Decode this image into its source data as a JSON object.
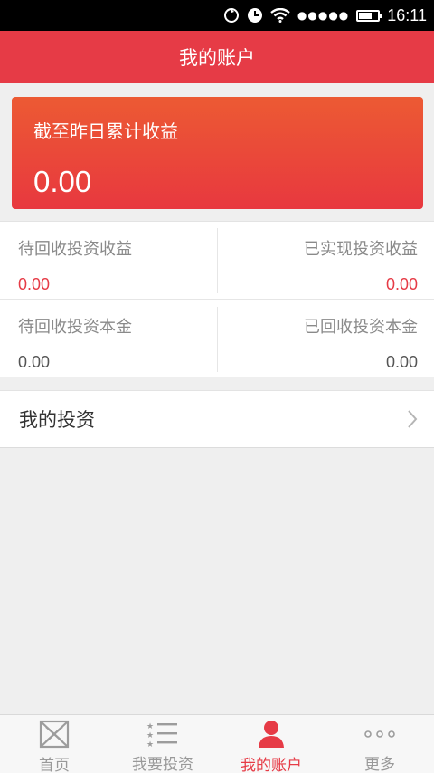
{
  "status_bar": {
    "time": "16:11",
    "signal_dots": "●●●●●"
  },
  "header": {
    "title": "我的账户"
  },
  "earnings_card": {
    "label": "截至昨日累计收益",
    "value": "0.00"
  },
  "stats": {
    "pending_income": {
      "label": "待回收投资收益",
      "value": "0.00"
    },
    "realized_income": {
      "label": "已实现投资收益",
      "value": "0.00"
    },
    "pending_principal": {
      "label": "待回收投资本金",
      "value": "0.00"
    },
    "recovered_principal": {
      "label": "已回收投资本金",
      "value": "0.00"
    }
  },
  "my_investments": {
    "label": "我的投资"
  },
  "tabbar": {
    "items": [
      {
        "label": "首页",
        "icon": "home-icon"
      },
      {
        "label": "我要投资",
        "icon": "list-icon"
      },
      {
        "label": "我的账户",
        "icon": "user-icon",
        "active": true
      },
      {
        "label": "更多",
        "icon": "more-icon"
      }
    ]
  },
  "colors": {
    "accent": "#e63b46",
    "card_top": "#ec5a33",
    "card_bottom": "#e8383f"
  }
}
